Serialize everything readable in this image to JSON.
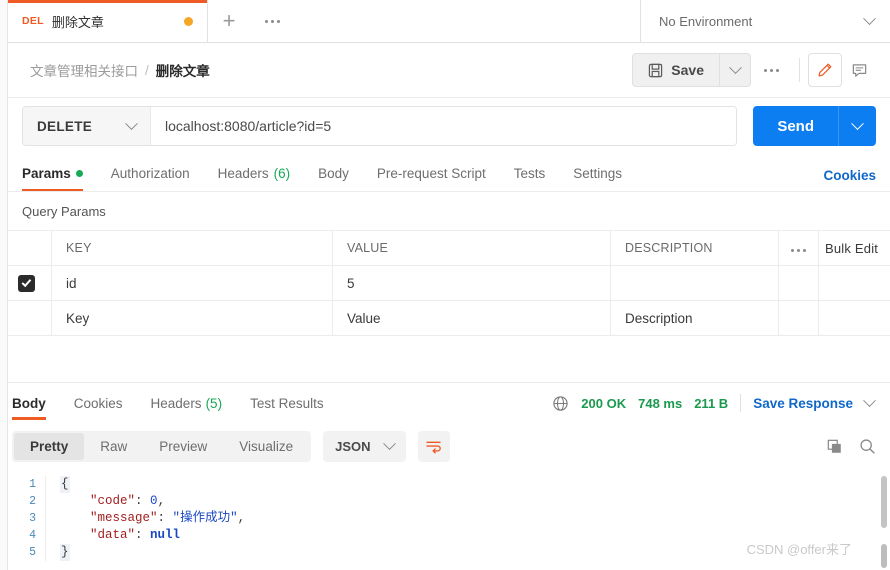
{
  "tab": {
    "method": "DEL",
    "name": "删除文章",
    "unsaved_dot": "unsaved",
    "new_tab_label": "+",
    "more_label": "more-options"
  },
  "environment": {
    "selected": "No Environment"
  },
  "breadcrumb": {
    "parent": "文章管理相关接口",
    "separator": "/",
    "current": "删除文章"
  },
  "toolbar": {
    "save_label": "Save",
    "save_icon": "floppy-disk-icon",
    "caret_icon": "chevron-down-icon",
    "more_icon": "ellipsis-icon",
    "edit_icon": "pencil-icon",
    "comment_icon": "comment-icon"
  },
  "request": {
    "method": "DELETE",
    "url": "localhost:8080/article?id=5",
    "url_placeholder": "Enter request URL",
    "send_label": "Send"
  },
  "request_tabs": [
    {
      "label": "Params",
      "dot": true,
      "active": true
    },
    {
      "label": "Authorization",
      "active": false
    },
    {
      "label": "Headers",
      "count": "(6)",
      "active": false
    },
    {
      "label": "Body",
      "active": false
    },
    {
      "label": "Pre-request Script",
      "active": false
    },
    {
      "label": "Tests",
      "active": false
    },
    {
      "label": "Settings",
      "active": false
    }
  ],
  "cookies_link": "Cookies",
  "params": {
    "section_title": "Query Params",
    "columns": [
      "KEY",
      "VALUE",
      "DESCRIPTION"
    ],
    "bulk_edit_label": "Bulk Edit",
    "rows": [
      {
        "checked": true,
        "key": "id",
        "value": "5",
        "description": ""
      }
    ],
    "placeholder_row": {
      "key": "Key",
      "value": "Value",
      "description": "Description"
    }
  },
  "response_tabs": [
    {
      "label": "Body",
      "active": true
    },
    {
      "label": "Cookies",
      "active": false
    },
    {
      "label": "Headers",
      "count": "(5)",
      "active": false
    },
    {
      "label": "Test Results",
      "active": false
    }
  ],
  "response_status": {
    "network_icon": "globe-icon",
    "status": "200 OK",
    "time": "748 ms",
    "size": "211 B",
    "save_response_label": "Save Response"
  },
  "format_bar": {
    "modes": [
      {
        "label": "Pretty",
        "selected": true
      },
      {
        "label": "Raw",
        "selected": false
      },
      {
        "label": "Preview",
        "selected": false
      },
      {
        "label": "Visualize",
        "selected": false
      }
    ],
    "language": "JSON",
    "wrap_icon": "word-wrap-icon",
    "copy_icon": "copy-icon",
    "search_icon": "search-icon"
  },
  "response_body": {
    "lines": [
      {
        "n": "1",
        "text": "{"
      },
      {
        "n": "2",
        "text": "    \"code\": 0,"
      },
      {
        "n": "3",
        "text": "    \"message\": \"操作成功\","
      },
      {
        "n": "4",
        "text": "    \"data\": null"
      },
      {
        "n": "5",
        "text": "}"
      }
    ],
    "json": {
      "code": "0",
      "message": "操作成功",
      "data": "null"
    }
  },
  "watermark": "CSDN @offer来了",
  "colors": {
    "accent_orange": "#ef5b25",
    "send_blue": "#0c7ef2",
    "link_blue": "#1068c9",
    "status_green": "#1a9a4e",
    "unsaved_dot": "#f5a623"
  }
}
